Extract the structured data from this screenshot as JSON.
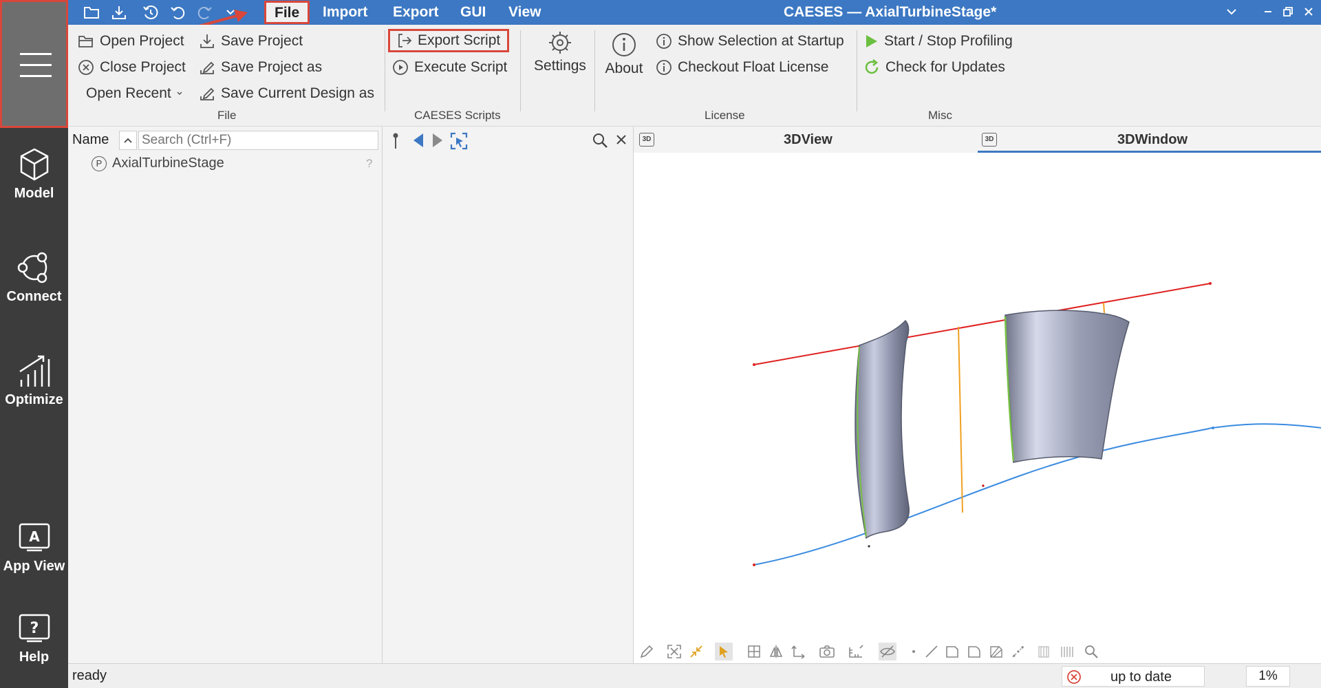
{
  "window": {
    "title": "CAESES — AxialTurbineStage*"
  },
  "menu": {
    "tabs": [
      "File",
      "Import",
      "Export",
      "GUI",
      "View"
    ],
    "active": "File"
  },
  "sidebar": {
    "items": [
      {
        "label": "Model",
        "icon": "cube-icon"
      },
      {
        "label": "Connect",
        "icon": "connect-icon"
      },
      {
        "label": "Optimize",
        "icon": "chart-icon"
      },
      {
        "label": "App View",
        "icon": "app-view-icon"
      },
      {
        "label": "Help",
        "icon": "help-icon"
      }
    ]
  },
  "ribbon": {
    "file": {
      "open_project": "Open Project",
      "close_project": "Close Project",
      "open_recent": "Open Recent",
      "save_project": "Save Project",
      "save_project_as": "Save Project as",
      "save_current_design_as": "Save Current Design as",
      "group_label": "File"
    },
    "scripts": {
      "export_script": "Export Script",
      "execute_script": "Execute Script",
      "group_label": "CAESES Scripts"
    },
    "settings": {
      "label": "Settings"
    },
    "license": {
      "about": "About",
      "show_selection": "Show Selection at Startup",
      "checkout_license": "Checkout Float License",
      "group_label": "License"
    },
    "misc": {
      "profiling": "Start / Stop Profiling",
      "updates": "Check for Updates",
      "group_label": "Misc"
    }
  },
  "tree": {
    "name_header": "Name",
    "search_placeholder": "Search (Ctrl+F)",
    "items": [
      {
        "badge": "P",
        "label": "AxialTurbineStage",
        "status": "?"
      }
    ]
  },
  "views": {
    "tabs": [
      "3DView",
      "3DWindow"
    ],
    "active": "3DWindow",
    "icon_text": "3D"
  },
  "status": {
    "text": "ready",
    "update_status": "up to date",
    "zoom": "1%"
  },
  "colors": {
    "accent": "#3c78c3",
    "highlight": "#d9473b",
    "sidebar": "#3c3c3c"
  }
}
